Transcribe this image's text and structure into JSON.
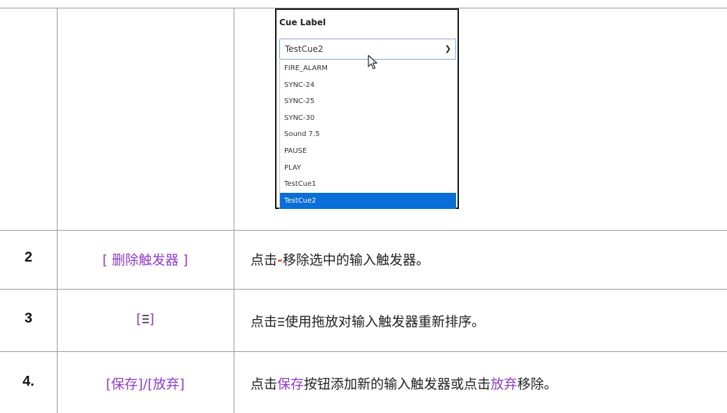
{
  "cue_dropdown": {
    "label": "Cue Label",
    "selected": "TestCue2",
    "chevron_icon": "chevron-down-icon",
    "options": [
      "FIRE_ALARM",
      "SYNC-24",
      "SYNC-25",
      "SYNC-30",
      "Sound 7.5",
      "PAUSE",
      "PLAY",
      "TestCue1",
      "TestCue2"
    ],
    "highlighted_option": "TestCue2",
    "highlight_color": "#0a6ed8"
  },
  "rows": [
    {
      "number": "2",
      "reference": "[ 删除触发器 ]",
      "desc_pre": "点击",
      "desc_symbol": "-",
      "desc_post": "移除选中的输入触发器。"
    },
    {
      "number": "3",
      "ref_open": "[",
      "ref_icon": "drag-handle-icon",
      "ref_close": "]",
      "desc_pre": "点击",
      "desc_icon": "drag-handle-icon",
      "desc_post": "使用拖放对输入触发器重新排序。"
    },
    {
      "number": "4.",
      "reference": "[保存]/[放弃]",
      "desc_pre": "点击",
      "desc_save": "保存",
      "desc_mid": "按钮添加新的输入触发器或点击",
      "desc_discard": "放弃",
      "desc_post": "移除。"
    }
  ],
  "colors": {
    "link_purple": "#8e3cc9",
    "grid_line": "#9a9a9a",
    "minus_orange": "#d85c2a"
  }
}
